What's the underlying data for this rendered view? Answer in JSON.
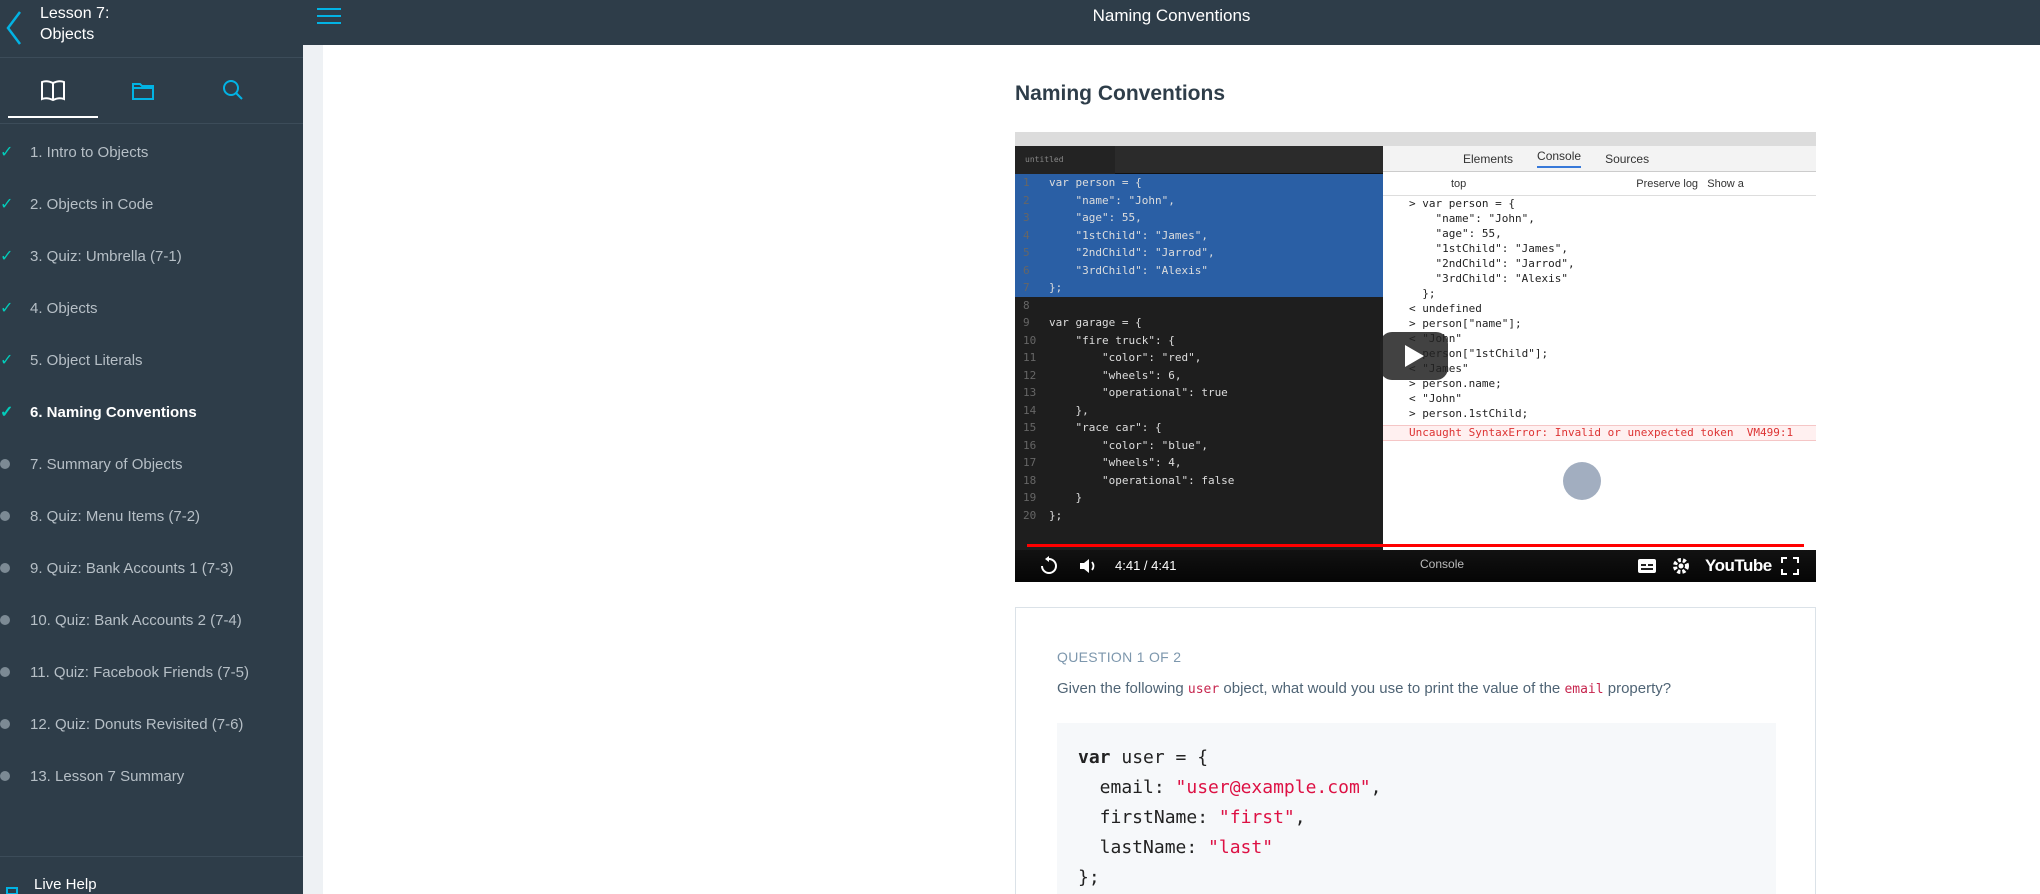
{
  "sidebar": {
    "lesson_title_line1": "Lesson 7:",
    "lesson_title_line2": "Objects",
    "tabs": [
      "book-icon",
      "folder-icon",
      "search-icon"
    ],
    "items": [
      {
        "label": "1. Intro to Objects",
        "status": "complete"
      },
      {
        "label": "2. Objects in Code",
        "status": "complete"
      },
      {
        "label": "3. Quiz: Umbrella (7-1)",
        "status": "complete"
      },
      {
        "label": "4. Objects",
        "status": "complete"
      },
      {
        "label": "5. Object Literals",
        "status": "complete"
      },
      {
        "label": "6. Naming Conventions",
        "status": "current"
      },
      {
        "label": "7. Summary of Objects",
        "status": "incomplete"
      },
      {
        "label": "8. Quiz: Menu Items (7-2)",
        "status": "incomplete"
      },
      {
        "label": "9. Quiz: Bank Accounts 1 (7-3)",
        "status": "incomplete"
      },
      {
        "label": "10. Quiz: Bank Accounts 2 (7-4)",
        "status": "incomplete"
      },
      {
        "label": "11. Quiz: Facebook Friends (7-5)",
        "status": "incomplete"
      },
      {
        "label": "12. Quiz: Donuts Revisited (7-6)",
        "status": "incomplete"
      },
      {
        "label": "13. Lesson 7 Summary",
        "status": "incomplete"
      }
    ],
    "live_help": "Live Help"
  },
  "header": {
    "title": "Naming Conventions"
  },
  "main": {
    "title": "Naming Conventions",
    "video": {
      "time": "4:41 / 4:41",
      "progress": 1.0,
      "brand": "YouTube",
      "console_label": "Console",
      "devtools_tabs": [
        "Elements",
        "Console",
        "Sources"
      ],
      "filter_context": "top",
      "filter_preserve": "Preserve log",
      "filter_show": "Show a",
      "editor_tab": "untitled",
      "code_lines": [
        "var person = {",
        "    \"name\": \"John\",",
        "    \"age\": 55,",
        "    \"1stChild\": \"James\",",
        "    \"2ndChild\": \"Jarrod\",",
        "    \"3rdChild\": \"Alexis\"",
        "};",
        "",
        "var garage = {",
        "    \"fire truck\": {",
        "        \"color\": \"red\",",
        "        \"wheels\": 6,",
        "        \"operational\": true",
        "    },",
        "    \"race car\": {",
        "        \"color\": \"blue\",",
        "        \"wheels\": 4,",
        "        \"operational\": false",
        "    }",
        "};"
      ],
      "console_lines": [
        "> var person = {",
        "    \"name\": \"John\",",
        "    \"age\": 55,",
        "    \"1stChild\": \"James\",",
        "    \"2ndChild\": \"Jarrod\",",
        "    \"3rdChild\": \"Alexis\"",
        "  };",
        "< undefined",
        "> person[\"name\"];",
        "< \"John\"",
        "> person[\"1stChild\"];",
        "< \"James\"",
        "> person.name;",
        "< \"John\"",
        "> person.1stChild;"
      ],
      "console_error": "Uncaught SyntaxError: Invalid or unexpected token",
      "console_error_ref": "VM499:1"
    },
    "quiz": {
      "number": "QUESTION 1 OF 2",
      "text_before": "Given the following ",
      "code1": "user",
      "text_middle": " object, what would you use to print the value of the ",
      "code2": "email",
      "text_after": " property?",
      "code_var": "var",
      "code_decl": " user = {",
      "code_lines": [
        {
          "key": "  email: ",
          "value": "\"user@example.com\"",
          "end": ","
        },
        {
          "key": "  firstName: ",
          "value": "\"first\"",
          "end": ","
        },
        {
          "key": "  lastName: ",
          "value": "\"last\"",
          "end": ""
        }
      ],
      "code_close": "};"
    }
  },
  "colors": {
    "sidebar_bg": "#2e3d49",
    "accent": "#02b3e4",
    "check": "#02ccba",
    "code_string": "#d14"
  }
}
